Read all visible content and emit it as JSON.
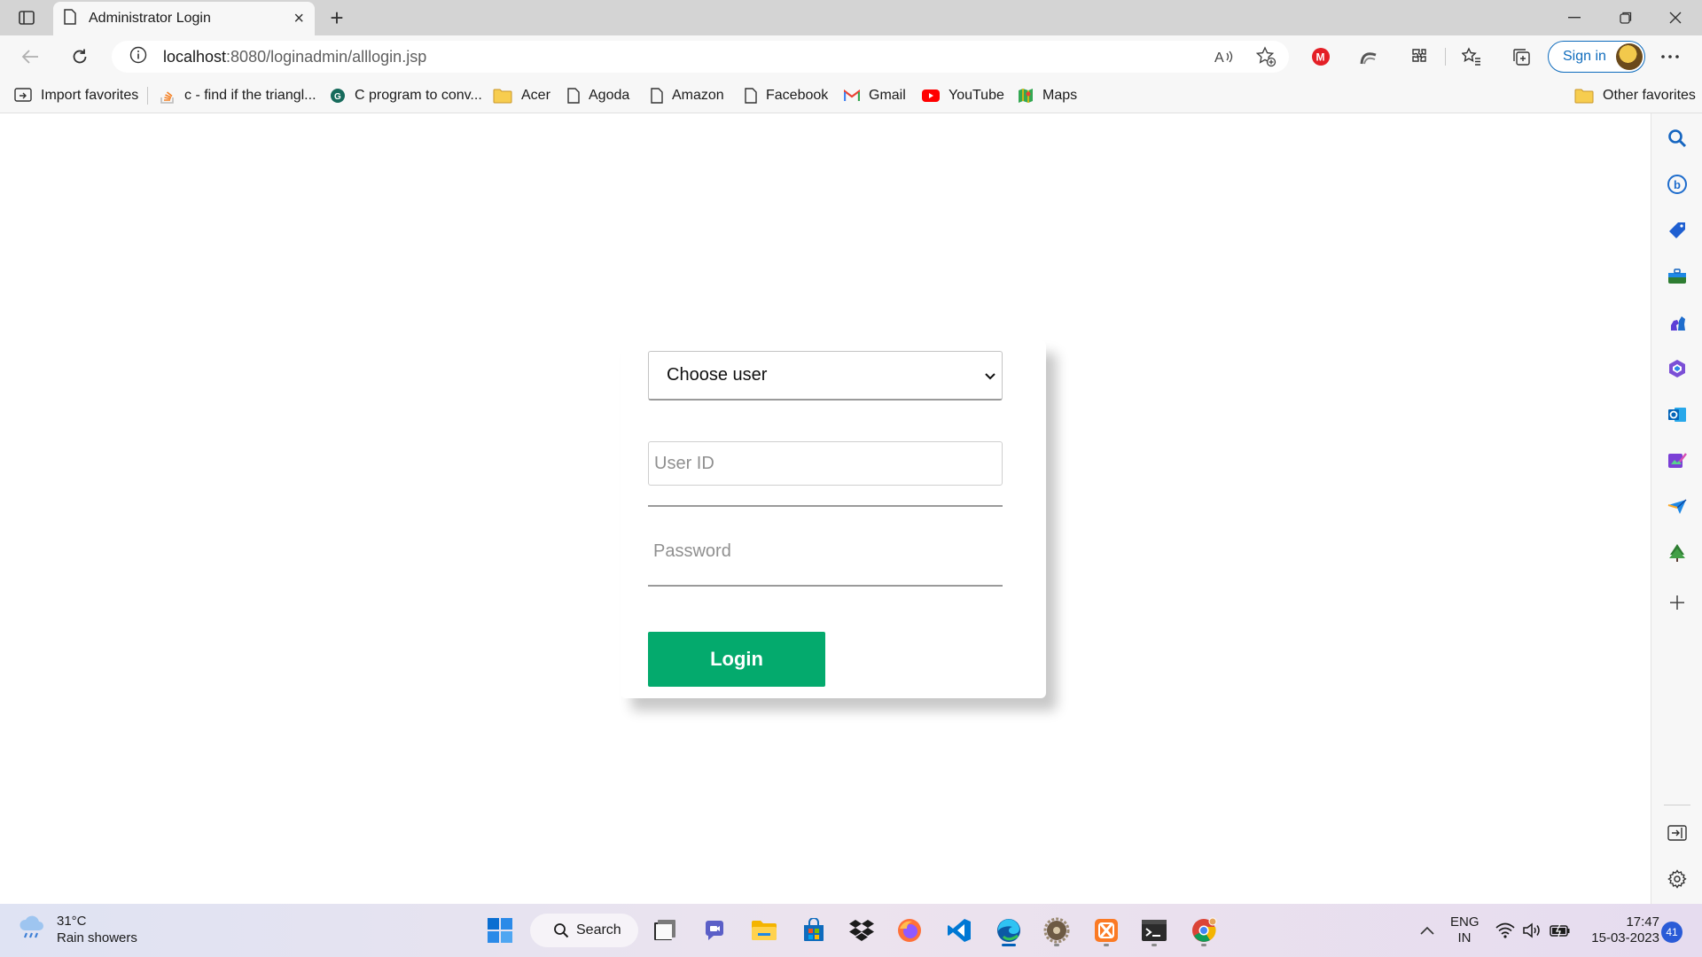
{
  "browser": {
    "tab_title": "Administrator Login",
    "tab_close": "×",
    "new_tab": "+",
    "url_host": "localhost",
    "url_rest": ":8080/loginadmin/alllogin.jsp",
    "sign_in": "Sign in"
  },
  "favorites": {
    "items": [
      {
        "label": "Import favorites",
        "icon": "import-icon"
      },
      {
        "label": "c - find if the triangl...",
        "icon": "stackoverflow-icon"
      },
      {
        "label": "C program to conv...",
        "icon": "site-icon"
      },
      {
        "label": "Acer",
        "icon": "folder-icon"
      },
      {
        "label": "Agoda",
        "icon": "page-icon"
      },
      {
        "label": "Amazon",
        "icon": "page-icon"
      },
      {
        "label": "Facebook",
        "icon": "page-icon"
      },
      {
        "label": "Gmail",
        "icon": "gmail-icon"
      },
      {
        "label": "YouTube",
        "icon": "youtube-icon"
      },
      {
        "label": "Maps",
        "icon": "maps-icon"
      }
    ],
    "other": "Other favorites"
  },
  "login": {
    "select_value": "Choose user",
    "userid_placeholder": "User ID",
    "password_placeholder": "Password",
    "button_label": "Login",
    "button_color": "#04aa6d"
  },
  "taskbar": {
    "weather_temp": "31°C",
    "weather_desc": "Rain showers",
    "search_label": "Search",
    "lang_top": "ENG",
    "lang_bottom": "IN",
    "time": "17:47",
    "date": "15-03-2023",
    "notifications": "41"
  }
}
